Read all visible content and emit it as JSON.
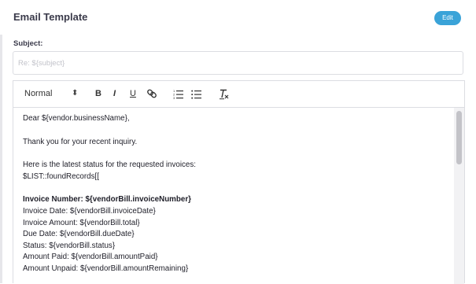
{
  "header": {
    "title": "Email Template",
    "edit_label": "Edit"
  },
  "subject": {
    "label": "Subject:",
    "placeholder": "Re: ${subject}"
  },
  "toolbar": {
    "format_label": "Normal",
    "format_arrows": "⬍",
    "bold_glyph": "B",
    "italic_glyph": "I",
    "underline_glyph": "U"
  },
  "body": {
    "lines": [
      "Dear ${vendor.businessName},",
      "Thank you for your recent inquiry.",
      "Here is the latest status for the requested invoices:",
      "$LIST::foundRecords[[",
      "Invoice Number: ${vendorBill.invoiceNumber}",
      "Invoice Date: ${vendorBill.invoiceDate}",
      "Invoice Amount: ${vendorBill.total}",
      "Due Date: ${vendorBill.dueDate}",
      "Status: ${vendorBill.status}",
      "Amount Paid: ${vendorBill.amountPaid}",
      "Amount Unpaid: ${vendorBill.amountRemaining}"
    ]
  }
}
